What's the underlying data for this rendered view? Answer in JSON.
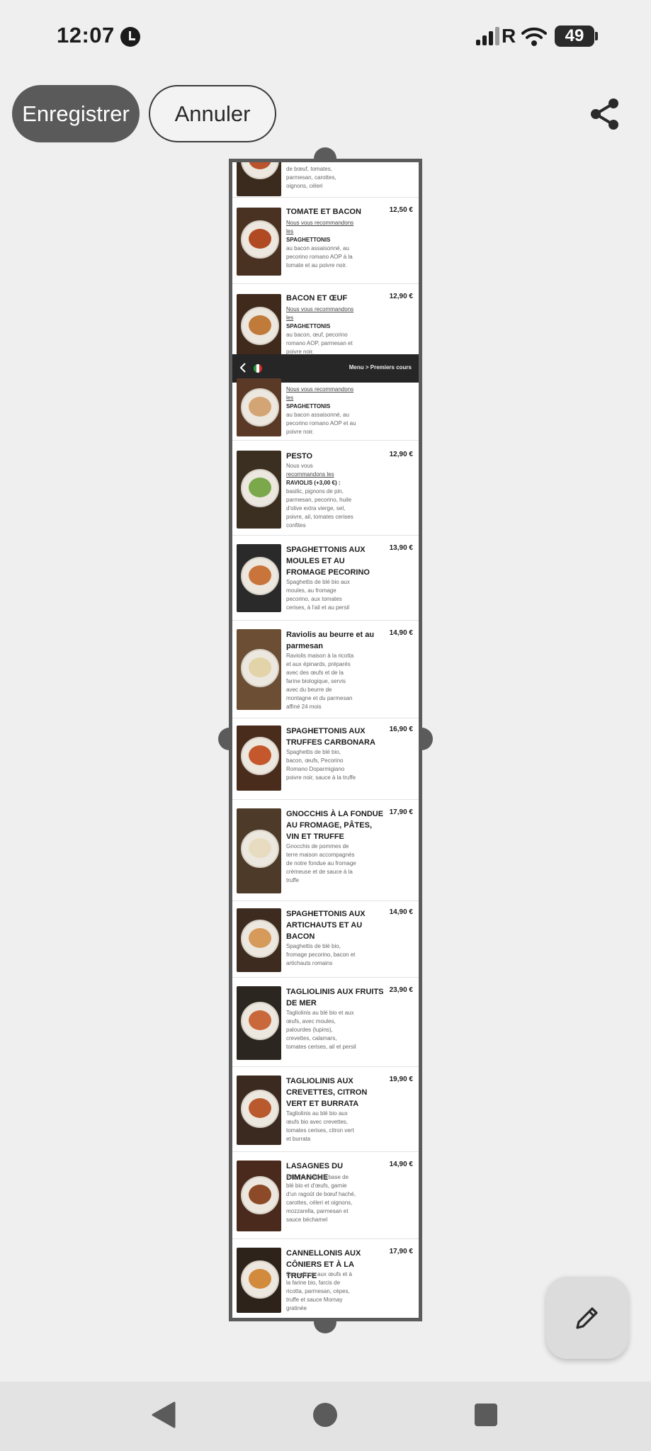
{
  "status_bar": {
    "time": "12:07",
    "carrier_letter": "R",
    "battery": "49"
  },
  "toolbar": {
    "save_label": "Enregistrer",
    "cancel_label": "Annuler"
  },
  "overlay": {
    "breadcrumb": "Menu > Premiers cours"
  },
  "menu_items": [
    {
      "name": "",
      "price": "",
      "desc": "de bœuf, tomates, parmesan, carottes, oignons, céleri"
    },
    {
      "name": "TOMATE ET BACON",
      "price": "12,50 €",
      "rec": "Nous vous recommandons les",
      "pasta": "SPAGHETTONIS",
      "desc": "au bacon assaisonné, au pecorino romano AOP à la tomate et au poivre noir."
    },
    {
      "name": "BACON ET ŒUF",
      "price": "12,90 €",
      "rec": "Nous vous recommandons les",
      "pasta": "SPAGHETTONIS",
      "desc": "au bacon, œuf, pecorino romano AOP, parmesan et poivre noir."
    },
    {
      "name": "",
      "price": "",
      "rec": "Nous vous recommandons les",
      "pasta": "SPAGHETTONIS",
      "desc": "au bacon assaisonné, au pecorino romano AOP et au poivre noir."
    },
    {
      "name": "PESTO",
      "price": "12,90 €",
      "rec": "Nous vous recommandons les",
      "pasta": "RAVIOLIS (+3,00 €) :",
      "desc": "basilic, pignons de pin, parmesan, pecorino, huile d'olive extra vierge, sel, poivre, ail, tomates cerises confites"
    },
    {
      "name": "SPAGHETTONIS AUX MOULES ET AU FROMAGE PECORINO",
      "price": "13,90 €",
      "desc": "Spaghettis de blé bio aux moules, au fromage pecorino, aux tomates cerises, à l'ail et au persil"
    },
    {
      "name": "Raviolis au beurre et au parmesan",
      "price": "14,90 €",
      "desc": "Raviolis maison à la ricotta et aux épinards, préparés avec des œufs et de la farine biologique, servis avec du beurre de montagne et du parmesan affiné 24 mois"
    },
    {
      "name": "SPAGHETTONIS AUX TRUFFES CARBONARA",
      "price": "16,90 €",
      "desc": "Spaghettis de blé bio, bacon, œufs, Pecorino Romano Doparmigiano poivre noir, sauce à la truffe"
    },
    {
      "name": "GNOCCHIS À LA FONDUE AU FROMAGE, PÂTES, VIN ET TRUFFE",
      "price": "17,90 €",
      "desc": "Gnocchis de pommes de terre maison accompagnés de notre fondue au fromage crémeuse et de sauce à la truffe"
    },
    {
      "name": "SPAGHETTONIS AUX ARTICHAUTS ET AU BACON",
      "price": "14,90 €",
      "desc": "Spaghettis de blé bio, fromage pecorino, bacon et artichauts romains"
    },
    {
      "name": "TAGLIOLINIS AUX FRUITS DE MER",
      "price": "23,90 €",
      "desc": "Tagliolinis au blé bio et aux œufs, avec moules, palourdes (lupins), crevettes, calamars, tomates cerises, ail et persil"
    },
    {
      "name": "TAGLIOLINIS AUX CREVETTES, CITRON VERT ET BURRATA",
      "price": "19,90 €",
      "desc": "Tagliolinis au blé bio aux œufs bio avec crevettes, tomates cerises, citron vert et burrata"
    },
    {
      "name": "LASAGNES DU DIMANCHE",
      "price": "14,90 €",
      "desc": "Pâte feuilletée à base de blé bio et d'œufs, garnie d'un ragoût de bœuf haché, carottes, céleri et oignons, mozzarella, parmesan et sauce béchamel"
    },
    {
      "name": "CANNELLONIS AUX CÔNIERS ET À LA TRUFFE",
      "price": "17,90 €",
      "desc": "Cannellonis aux œufs et à la farine bio, farcis de ricotta, parmesan, cèpes, truffe et sauce Mornay gratinée"
    }
  ],
  "colors": {
    "save_button_bg": "#5a5a5a",
    "frame": "#5b5b5b",
    "overlay_bar": "#262626"
  },
  "icons": {
    "share": "share-icon",
    "edit": "pencil-icon",
    "back": "chevron-left-icon",
    "flag": "italy-flag-icon"
  }
}
